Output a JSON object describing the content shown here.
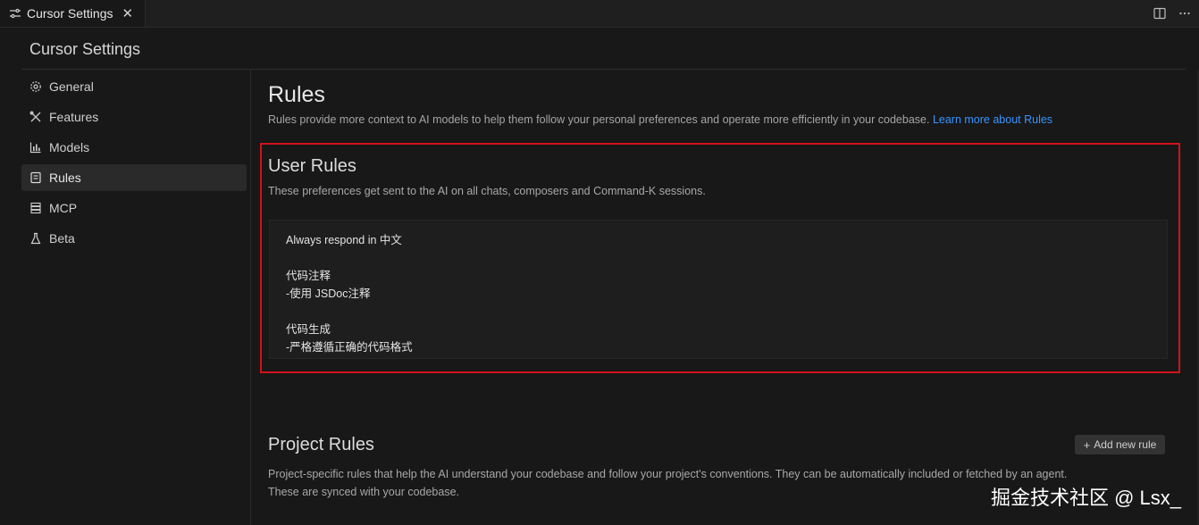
{
  "tab": {
    "label": "Cursor Settings",
    "close": "✕"
  },
  "settings_title": "Cursor Settings",
  "sidebar": {
    "items": [
      {
        "label": "General",
        "icon": "gear-icon"
      },
      {
        "label": "Features",
        "icon": "tools-icon"
      },
      {
        "label": "Models",
        "icon": "chart-icon"
      },
      {
        "label": "Rules",
        "icon": "document-icon",
        "active": true
      },
      {
        "label": "MCP",
        "icon": "server-icon"
      },
      {
        "label": "Beta",
        "icon": "flask-icon"
      }
    ]
  },
  "main": {
    "title": "Rules",
    "description": "Rules provide more context to AI models to help them follow your personal preferences and operate more efficiently in your codebase.",
    "learn_more": "Learn more about Rules",
    "user_rules": {
      "title": "User Rules",
      "description": "These preferences get sent to the AI on all chats, composers and Command-K sessions.",
      "lines": [
        "Always respond in 中文",
        "",
        "代码注释",
        "-使用 JSDoc注释",
        "",
        "代码生成",
        "-严格遵循正确的代码格式"
      ]
    },
    "project_rules": {
      "title": "Project Rules",
      "add_button": "Add new rule",
      "description_1": "Project-specific rules that help the AI understand your codebase and follow your project's conventions. They can be automatically included or fetched by an agent.",
      "description_2": "These are synced with your codebase."
    }
  },
  "watermark": "掘金技术社区 @ Lsx_",
  "colors": {
    "highlight_border": "#d0121b",
    "link": "#3794ff",
    "background": "#181818"
  }
}
